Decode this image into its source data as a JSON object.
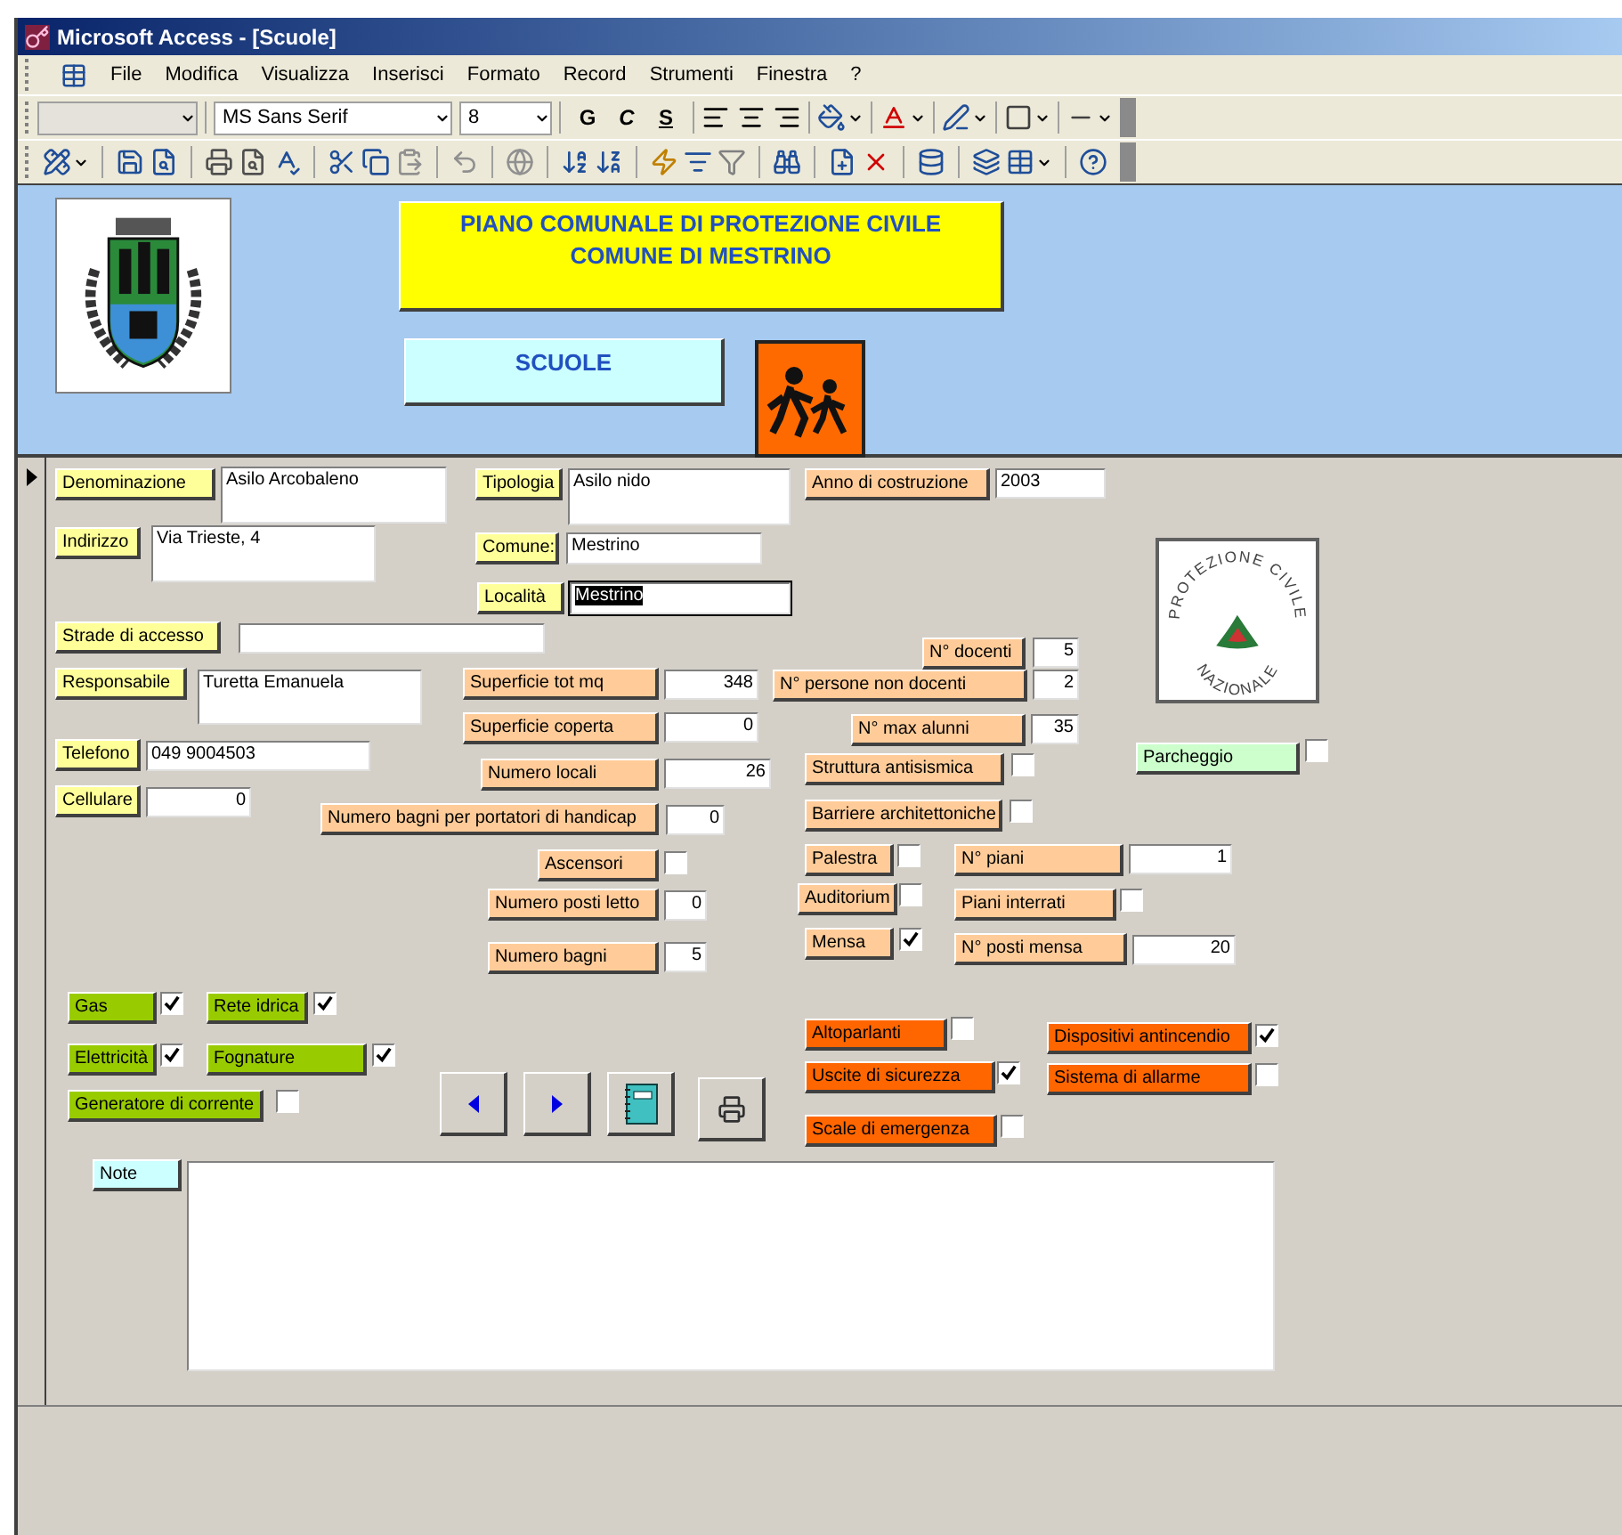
{
  "window": {
    "title": "Microsoft Access - [Scuole]"
  },
  "menu": [
    "File",
    "Modifica",
    "Visualizza",
    "Inserisci",
    "Formato",
    "Record",
    "Strumenti",
    "Finestra",
    "?"
  ],
  "format_toolbar": {
    "object_box": {
      "disabled": true
    },
    "font_name": "MS Sans Serif",
    "font_size": "8",
    "style_buttons": [
      "G",
      "C",
      "S"
    ]
  },
  "header": {
    "title_lines": [
      "PIANO COMUNALE DI PROTEZIONE CIVILE",
      "COMUNE DI MESTRINO"
    ],
    "section": "SCUOLE"
  },
  "logo": {
    "top_text": "PROTEZIONE CIVILE",
    "bottom_text": "NAZIONALE"
  },
  "fields": [
    {
      "kind": "text",
      "label": "Denominazione",
      "color": "#ffff99",
      "value": "Asilo Arcobaleno",
      "focused": false
    },
    {
      "kind": "text",
      "label": "Tipologia",
      "color": "#ffff99",
      "value": "Asilo nido",
      "focused": false
    },
    {
      "kind": "text",
      "label": "Anno di costruzione",
      "color": "#ffcc99",
      "value": "2003",
      "focused": false
    },
    {
      "kind": "text",
      "label": "Indirizzo",
      "color": "#ffff99",
      "value": "Via Trieste, 4",
      "focused": false
    },
    {
      "kind": "text",
      "label": "Comune:",
      "color": "#ffff99",
      "value": "Mestrino",
      "focused": false
    },
    {
      "kind": "text",
      "label": "Località",
      "color": "#ffff99",
      "value": "Mestrino",
      "focused": true
    },
    {
      "kind": "text",
      "label": "Strade di accesso",
      "color": "#ffff99",
      "focused": false
    },
    {
      "kind": "text",
      "label": "N° docenti",
      "color": "#ffcc99",
      "value": "5",
      "focused": false
    },
    {
      "kind": "text",
      "label": "Responsabile",
      "color": "#ffff99",
      "value": "Turetta Emanuela",
      "focused": false
    },
    {
      "kind": "text",
      "label": "Superficie tot mq",
      "color": "#ffcc99",
      "value": "348",
      "focused": false
    },
    {
      "kind": "text",
      "label": "N° persone non docenti",
      "color": "#ffcc99",
      "value": "2",
      "focused": false
    },
    {
      "kind": "text",
      "label": "Superficie coperta",
      "color": "#ffcc99",
      "value": "0",
      "focused": false
    },
    {
      "kind": "text",
      "label": "N° max alunni",
      "color": "#ffcc99",
      "value": "35",
      "focused": false
    },
    {
      "kind": "text",
      "label": "Telefono",
      "color": "#ffff99",
      "value": "049 9004503",
      "focused": false
    },
    {
      "kind": "check",
      "label": "Parcheggio",
      "color": "#ccffcc",
      "checked": false
    },
    {
      "kind": "text",
      "label": "Numero locali",
      "color": "#ffcc99",
      "value": "26",
      "focused": false
    },
    {
      "kind": "check",
      "label": "Struttura antisismica",
      "color": "#ffcc99",
      "checked": false
    },
    {
      "kind": "text",
      "label": "Cellulare",
      "color": "#ffff99",
      "value": "0",
      "focused": false
    },
    {
      "kind": "text",
      "label": "Numero bagni per portatori di handicap",
      "color": "#ffcc99",
      "value": "0",
      "focused": false
    },
    {
      "kind": "check",
      "label": "Barriere architettoniche",
      "color": "#ffcc99",
      "checked": false
    },
    {
      "kind": "check",
      "label": "Ascensori",
      "color": "#ffcc99",
      "checked": false
    },
    {
      "kind": "check",
      "label": "Palestra",
      "color": "#ffcc99",
      "checked": false
    },
    {
      "kind": "text",
      "label": "N° piani",
      "color": "#ffcc99",
      "value": "1",
      "focused": false
    },
    {
      "kind": "text",
      "label": "Numero posti letto",
      "color": "#ffcc99",
      "value": "0",
      "focused": false
    },
    {
      "kind": "check",
      "label": "Auditorium",
      "color": "#ffcc99",
      "checked": false
    },
    {
      "kind": "check",
      "label": "Piani interrati",
      "color": "#ffcc99",
      "checked": false
    },
    {
      "kind": "text",
      "label": "Numero bagni",
      "color": "#ffcc99",
      "value": "5",
      "focused": false
    },
    {
      "kind": "check",
      "label": "Mensa",
      "color": "#ffcc99",
      "checked": true
    },
    {
      "kind": "text",
      "label": "N° posti mensa",
      "color": "#ffcc99",
      "value": "20",
      "focused": false
    },
    {
      "kind": "check",
      "label": "Gas",
      "color": "#99cc00",
      "checked": true
    },
    {
      "kind": "check",
      "label": "Rete idrica",
      "color": "#99cc00",
      "checked": true
    },
    {
      "kind": "check",
      "label": "Altoparlanti",
      "color": "#ff6600",
      "checked": false
    },
    {
      "kind": "check",
      "label": "Dispositivi antincendio",
      "color": "#ff6600",
      "checked": true
    },
    {
      "kind": "check",
      "label": "Elettricità",
      "color": "#99cc00",
      "checked": true
    },
    {
      "kind": "check",
      "label": "Fognature",
      "color": "#99cc00",
      "checked": true
    },
    {
      "kind": "check",
      "label": "Uscite di sicurezza",
      "color": "#ff6600",
      "checked": true
    },
    {
      "kind": "check",
      "label": "Sistema di allarme",
      "color": "#ff6600",
      "checked": false
    },
    {
      "kind": "check",
      "label": "Generatore di corrente",
      "color": "#99cc00",
      "checked": false
    },
    {
      "kind": "check",
      "label": "Scale di emergenza",
      "color": "#ff6600",
      "checked": false
    },
    {
      "kind": "text",
      "label": "Note",
      "color": "#ccffff",
      "focused": false
    }
  ]
}
